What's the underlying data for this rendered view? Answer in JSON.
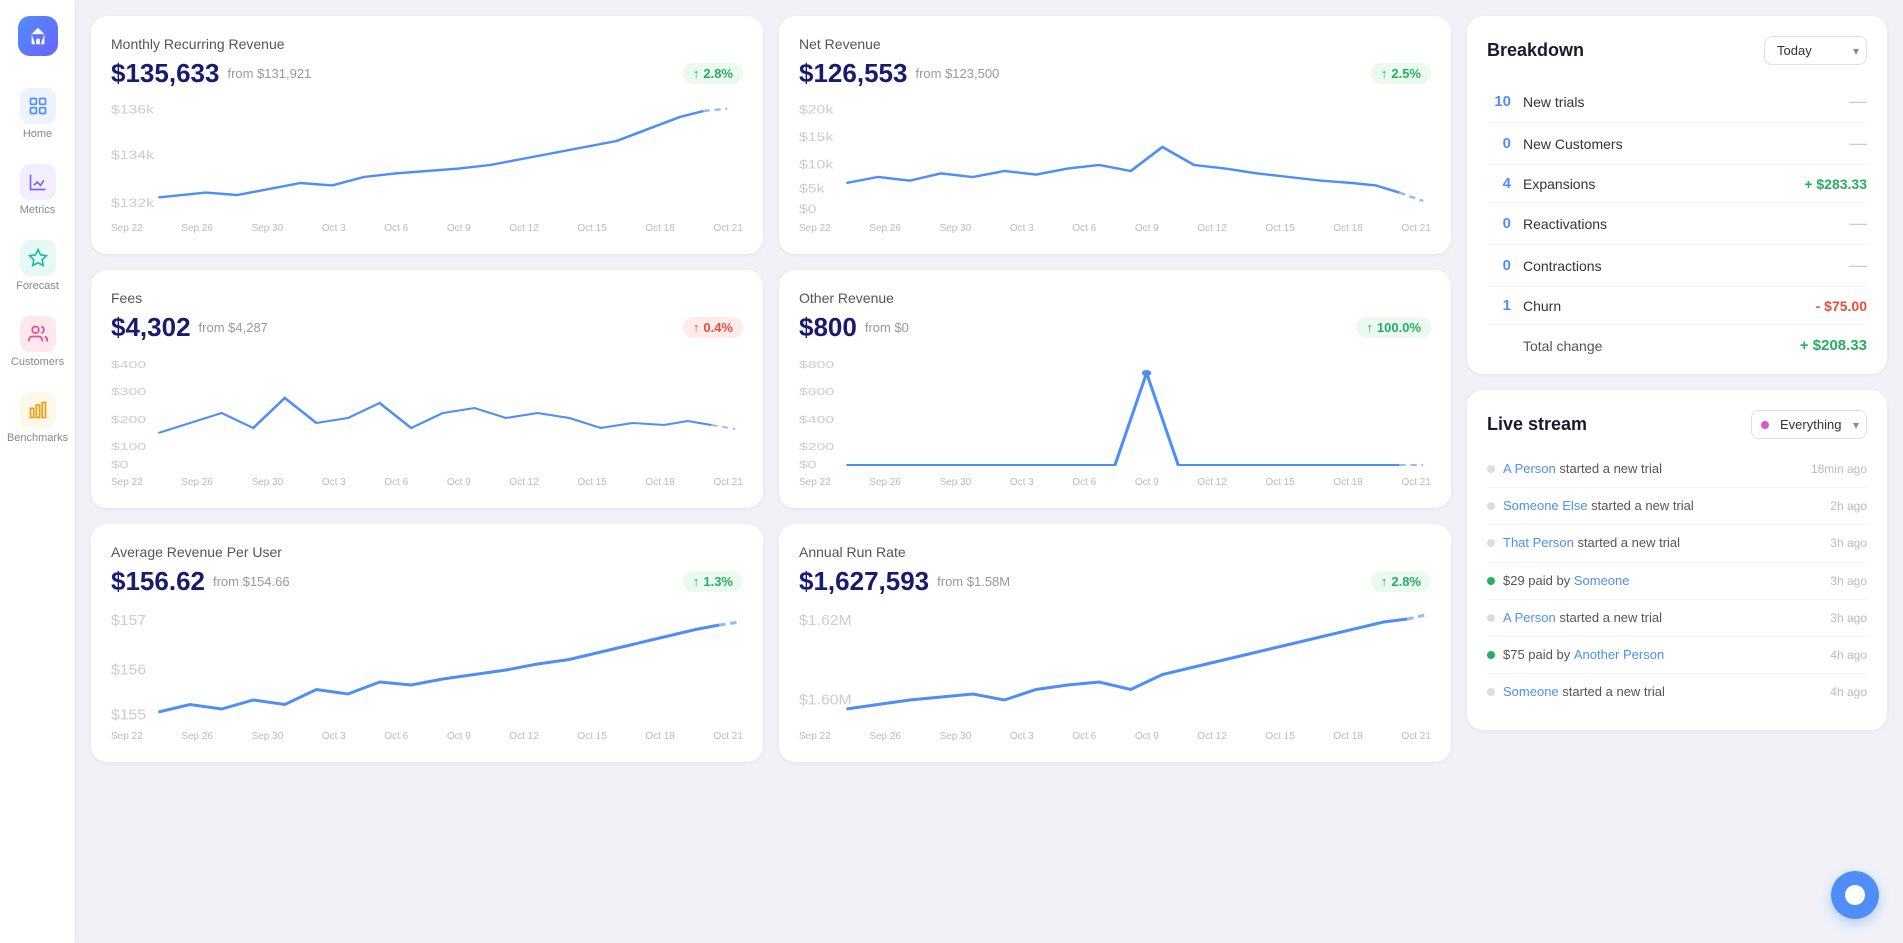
{
  "sidebar": {
    "items": [
      {
        "label": "Home",
        "icon": "home-icon",
        "active": false
      },
      {
        "label": "Metrics",
        "icon": "metrics-icon",
        "active": false
      },
      {
        "label": "Forecast",
        "icon": "forecast-icon",
        "active": false
      },
      {
        "label": "Customers",
        "icon": "customers-icon",
        "active": false
      },
      {
        "label": "Benchmarks",
        "icon": "benchmarks-icon",
        "active": false
      }
    ]
  },
  "breakdown": {
    "title": "Breakdown",
    "period_label": "Today",
    "rows": [
      {
        "count": "10",
        "label": "New trials",
        "value": null
      },
      {
        "count": "0",
        "label": "New Customers",
        "value": null
      },
      {
        "count": "4",
        "label": "Expansions",
        "value": "+ $283.33",
        "type": "green"
      },
      {
        "count": "0",
        "label": "Reactivations",
        "value": null
      },
      {
        "count": "0",
        "label": "Contractions",
        "value": null
      },
      {
        "count": "1",
        "label": "Churn",
        "value": "- $75.00",
        "type": "red"
      }
    ],
    "total_label": "Total change",
    "total_value": "+ $208.33"
  },
  "livestream": {
    "title": "Live stream",
    "filter": "Everything",
    "items": [
      {
        "dot": "gray",
        "text_pre": "",
        "link": "A Person",
        "text_post": " started a new trial",
        "time": "18min ago"
      },
      {
        "dot": "gray",
        "text_pre": "",
        "link": "Someone Else",
        "text_post": " started a new trial",
        "time": "2h ago"
      },
      {
        "dot": "gray",
        "text_pre": "",
        "link": "That Person",
        "text_post": " started a new trial",
        "time": "3h ago"
      },
      {
        "dot": "green",
        "text_pre": "$29 paid by ",
        "link": "Someone",
        "text_post": "",
        "time": "3h ago"
      },
      {
        "dot": "gray",
        "text_pre": "",
        "link": "A Person",
        "text_post": " started a new trial",
        "time": "3h ago"
      },
      {
        "dot": "green",
        "text_pre": "$75 paid by ",
        "link": "Another Person",
        "text_post": "",
        "time": "4h ago"
      },
      {
        "dot": "gray",
        "text_pre": "",
        "link": "Someone",
        "text_post": " started a new trial",
        "time": "4h ago"
      }
    ]
  },
  "charts": {
    "mrr": {
      "title": "Monthly Recurring Revenue",
      "value": "$135,633",
      "from": "from $131,921",
      "pct": "2.8%",
      "pct_type": "green",
      "x_labels": [
        "Sep 22",
        "Sep 26",
        "Sep 30",
        "Oct 3",
        "Oct 6",
        "Oct 9",
        "Oct 12",
        "Oct 15",
        "Oct 18",
        "Oct 21"
      ],
      "y_labels": [
        "$136k",
        "$134k",
        "$132k"
      ]
    },
    "net": {
      "title": "Net Revenue",
      "value": "$126,553",
      "from": "from $123,500",
      "pct": "2.5%",
      "pct_type": "green",
      "x_labels": [
        "Sep 22",
        "Sep 26",
        "Sep 30",
        "Oct 3",
        "Oct 6",
        "Oct 9",
        "Oct 12",
        "Oct 15",
        "Oct 18",
        "Oct 21"
      ],
      "y_labels": [
        "$20k",
        "$15k",
        "$10k",
        "$5k",
        "$0"
      ]
    },
    "fees": {
      "title": "Fees",
      "value": "$4,302",
      "from": "from $4,287",
      "pct": "0.4%",
      "pct_type": "red",
      "x_labels": [
        "Sep 22",
        "Sep 26",
        "Sep 30",
        "Oct 3",
        "Oct 6",
        "Oct 9",
        "Oct 12",
        "Oct 15",
        "Oct 18",
        "Oct 21"
      ],
      "y_labels": [
        "$400",
        "$300",
        "$200",
        "$100",
        "$0"
      ]
    },
    "other": {
      "title": "Other Revenue",
      "value": "$800",
      "from": "from $0",
      "pct": "100.0%",
      "pct_type": "green",
      "x_labels": [
        "Sep 22",
        "Sep 26",
        "Sep 30",
        "Oct 3",
        "Oct 6",
        "Oct 9",
        "Oct 12",
        "Oct 15",
        "Oct 18",
        "Oct 21"
      ],
      "y_labels": [
        "$800",
        "$600",
        "$400",
        "$200",
        "$0"
      ]
    },
    "arpu": {
      "title": "Average Revenue Per User",
      "value": "$156.62",
      "from": "from $154.66",
      "pct": "1.3%",
      "pct_type": "green",
      "x_labels": [
        "Sep 22",
        "Sep 26",
        "Sep 30",
        "Oct 3",
        "Oct 6",
        "Oct 9",
        "Oct 12",
        "Oct 15",
        "Oct 18",
        "Oct 21"
      ],
      "y_labels": [
        "$157",
        "$156",
        "$155"
      ]
    },
    "arr": {
      "title": "Annual Run Rate",
      "value": "$1,627,593",
      "from": "from $1.58M",
      "pct": "2.8%",
      "pct_type": "green",
      "x_labels": [
        "Sep 22",
        "Sep 26",
        "Sep 30",
        "Oct 3",
        "Oct 6",
        "Oct 9",
        "Oct 12",
        "Oct 15",
        "Oct 18",
        "Oct 21"
      ],
      "y_labels": [
        "$1.62M",
        "$1.60M"
      ]
    }
  }
}
